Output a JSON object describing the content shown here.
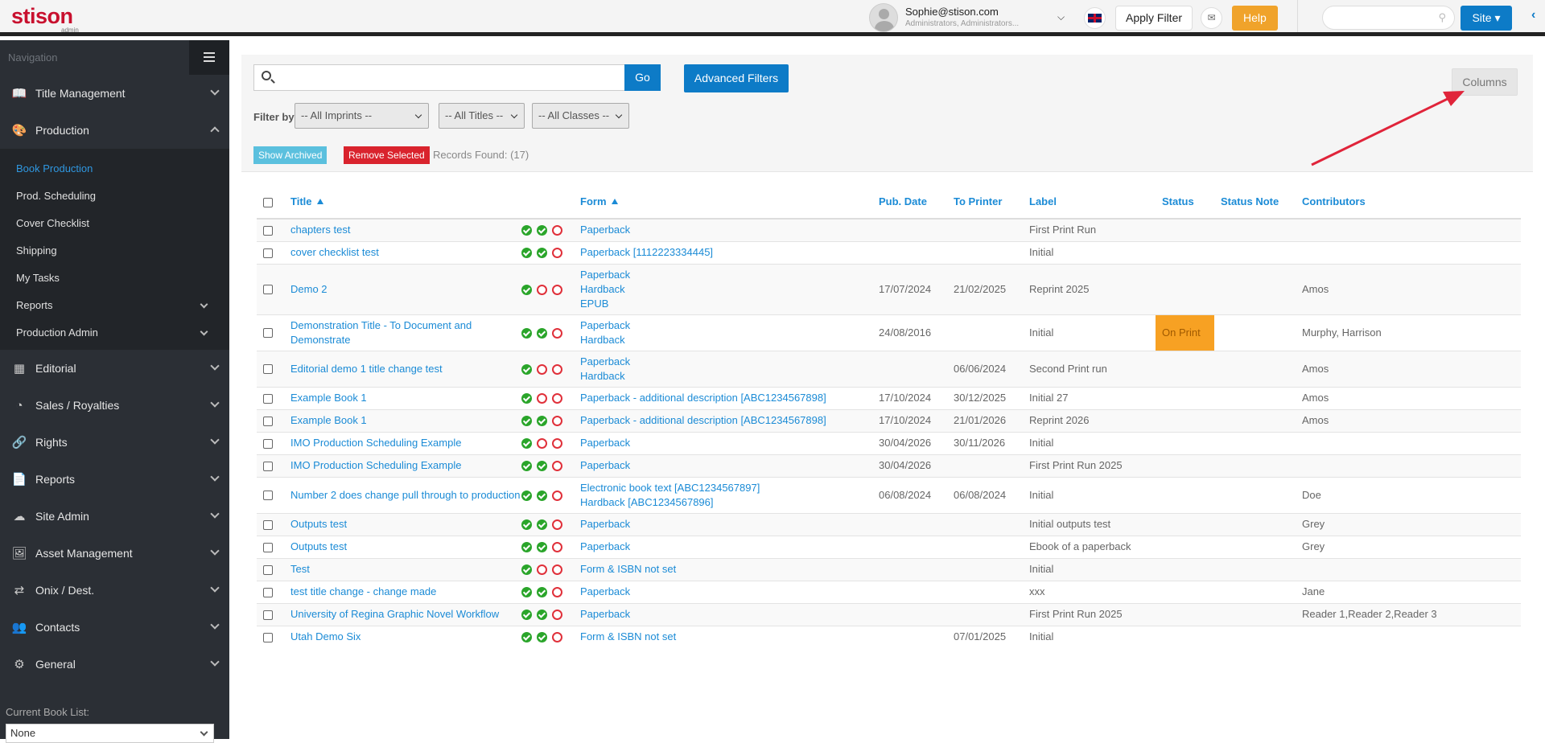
{
  "header": {
    "logo_text": "stison",
    "logo_sub": "admin",
    "user_email": "Sophie@stison.com",
    "user_roles": "Administrators, Administrators...",
    "apply_filter": "Apply Filter",
    "help": "Help",
    "site": "Site"
  },
  "sidebar": {
    "nav_label": "Navigation",
    "items": [
      {
        "label": "Title Management",
        "icon": "book-icon"
      },
      {
        "label": "Production",
        "icon": "palette-icon"
      },
      {
        "label": "Editorial",
        "icon": "map-icon"
      },
      {
        "label": "Sales / Royalties",
        "icon": "pie-chart-icon"
      },
      {
        "label": "Rights",
        "icon": "link-icon"
      },
      {
        "label": "Reports",
        "icon": "document-icon"
      },
      {
        "label": "Site Admin",
        "icon": "cloud-icon"
      },
      {
        "label": "Asset Management",
        "icon": "image-icon"
      },
      {
        "label": "Onix / Dest.",
        "icon": "exchange-icon"
      },
      {
        "label": "Contacts",
        "icon": "users-icon"
      },
      {
        "label": "General",
        "icon": "gears-icon"
      }
    ],
    "production_sub": [
      {
        "label": "Book Production"
      },
      {
        "label": "Prod. Scheduling"
      },
      {
        "label": "Cover Checklist"
      },
      {
        "label": "Shipping"
      },
      {
        "label": "My Tasks"
      },
      {
        "label": "Reports"
      },
      {
        "label": "Production Admin"
      }
    ],
    "booklist_label": "Current Book List:",
    "booklist_value": "None"
  },
  "filters": {
    "go": "Go",
    "advanced": "Advanced Filters",
    "columns": "Columns",
    "filter_by": "Filter by:",
    "imprints": "-- All Imprints --",
    "titles": "-- All Titles --",
    "classes": "-- All Classes --",
    "show_archived": "Show Archived",
    "remove_selected": "Remove Selected",
    "records": "Records Found: (17)"
  },
  "table": {
    "headers": {
      "title": "Title",
      "form": "Form",
      "pub_date": "Pub. Date",
      "to_printer": "To Printer",
      "label": "Label",
      "status": "Status",
      "status_note": "Status Note",
      "contributors": "Contributors"
    },
    "rows": [
      {
        "title": "chapters test",
        "icons": [
          "ok",
          "ok",
          "no"
        ],
        "forms": [
          "Paperback"
        ],
        "pub": "",
        "printer": "",
        "label": "First Print Run",
        "status": "",
        "note": "",
        "contrib": ""
      },
      {
        "title": "cover checklist test",
        "icons": [
          "ok",
          "ok",
          "no"
        ],
        "forms": [
          "Paperback [1112223334445]"
        ],
        "pub": "",
        "printer": "",
        "label": "Initial",
        "status": "",
        "note": "",
        "contrib": ""
      },
      {
        "title": "Demo 2",
        "icons": [
          "ok",
          "no",
          "no"
        ],
        "forms": [
          "Paperback",
          "Hardback",
          "EPUB"
        ],
        "pub": "17/07/2024",
        "printer": "21/02/2025",
        "label": "Reprint 2025",
        "status": "",
        "note": "",
        "contrib": "Amos"
      },
      {
        "title": "Demonstration Title - To Document and Demonstrate",
        "icons": [
          "ok",
          "ok",
          "no"
        ],
        "forms": [
          "Paperback",
          "Hardback"
        ],
        "pub": "24/08/2016",
        "printer": "",
        "label": "Initial",
        "status": "On Print",
        "note": "",
        "contrib": "Murphy, Harrison"
      },
      {
        "title": "Editorial demo 1 title change test",
        "icons": [
          "ok",
          "no",
          "no"
        ],
        "forms": [
          "Paperback",
          "Hardback"
        ],
        "pub": "",
        "printer": "06/06/2024",
        "label": "Second Print run",
        "status": "",
        "note": "",
        "contrib": "Amos"
      },
      {
        "title": "Example Book 1",
        "icons": [
          "ok",
          "no",
          "no"
        ],
        "forms": [
          "Paperback - additional description [ABC1234567898]"
        ],
        "pub": "17/10/2024",
        "printer": "30/12/2025",
        "label": "Initial 27",
        "status": "",
        "note": "",
        "contrib": "Amos"
      },
      {
        "title": "Example Book 1",
        "icons": [
          "ok",
          "ok",
          "no"
        ],
        "forms": [
          "Paperback - additional description [ABC1234567898]"
        ],
        "pub": "17/10/2024",
        "printer": "21/01/2026",
        "label": "Reprint 2026",
        "status": "",
        "note": "",
        "contrib": "Amos"
      },
      {
        "title": "IMO Production Scheduling Example",
        "icons": [
          "ok",
          "no",
          "no"
        ],
        "forms": [
          "Paperback"
        ],
        "pub": "30/04/2026",
        "printer": "30/11/2026",
        "label": "Initial",
        "status": "",
        "note": "",
        "contrib": ""
      },
      {
        "title": "IMO Production Scheduling Example",
        "icons": [
          "ok",
          "ok",
          "no"
        ],
        "forms": [
          "Paperback"
        ],
        "pub": "30/04/2026",
        "printer": "",
        "label": "First Print Run 2025",
        "status": "",
        "note": "",
        "contrib": ""
      },
      {
        "title": "Number 2 does change pull through to production",
        "icons": [
          "ok",
          "ok",
          "no"
        ],
        "forms": [
          "Electronic book text [ABC1234567897]",
          "Hardback [ABC1234567896]"
        ],
        "pub": "06/08/2024",
        "printer": "06/08/2024",
        "label": "Initial",
        "status": "",
        "note": "",
        "contrib": "Doe"
      },
      {
        "title": "Outputs test",
        "icons": [
          "ok",
          "ok",
          "no"
        ],
        "forms": [
          "Paperback"
        ],
        "pub": "",
        "printer": "",
        "label": "Initial outputs test",
        "status": "",
        "note": "",
        "contrib": "Grey"
      },
      {
        "title": "Outputs test",
        "icons": [
          "ok",
          "ok",
          "no"
        ],
        "forms": [
          "Paperback"
        ],
        "pub": "",
        "printer": "",
        "label": "Ebook of a paperback",
        "status": "",
        "note": "",
        "contrib": "Grey"
      },
      {
        "title": "Test",
        "icons": [
          "ok",
          "no",
          "no"
        ],
        "forms": [
          "Form & ISBN not set"
        ],
        "pub": "",
        "printer": "",
        "label": "Initial",
        "status": "",
        "note": "",
        "contrib": ""
      },
      {
        "title": "test title change - change made",
        "icons": [
          "ok",
          "ok",
          "no"
        ],
        "forms": [
          "Paperback"
        ],
        "pub": "",
        "printer": "",
        "label": "xxx",
        "status": "",
        "note": "",
        "contrib": "Jane"
      },
      {
        "title": "University of Regina Graphic Novel Workflow",
        "icons": [
          "ok",
          "ok",
          "no"
        ],
        "forms": [
          "Paperback"
        ],
        "pub": "",
        "printer": "",
        "label": "First Print Run 2025",
        "status": "",
        "note": "",
        "contrib": "Reader 1,Reader 2,Reader 3"
      },
      {
        "title": "Utah Demo Six",
        "icons": [
          "ok",
          "ok",
          "no"
        ],
        "forms": [
          "Form & ISBN not set"
        ],
        "pub": "",
        "printer": "07/01/2025",
        "label": "Initial",
        "status": "",
        "note": "",
        "contrib": ""
      }
    ]
  }
}
